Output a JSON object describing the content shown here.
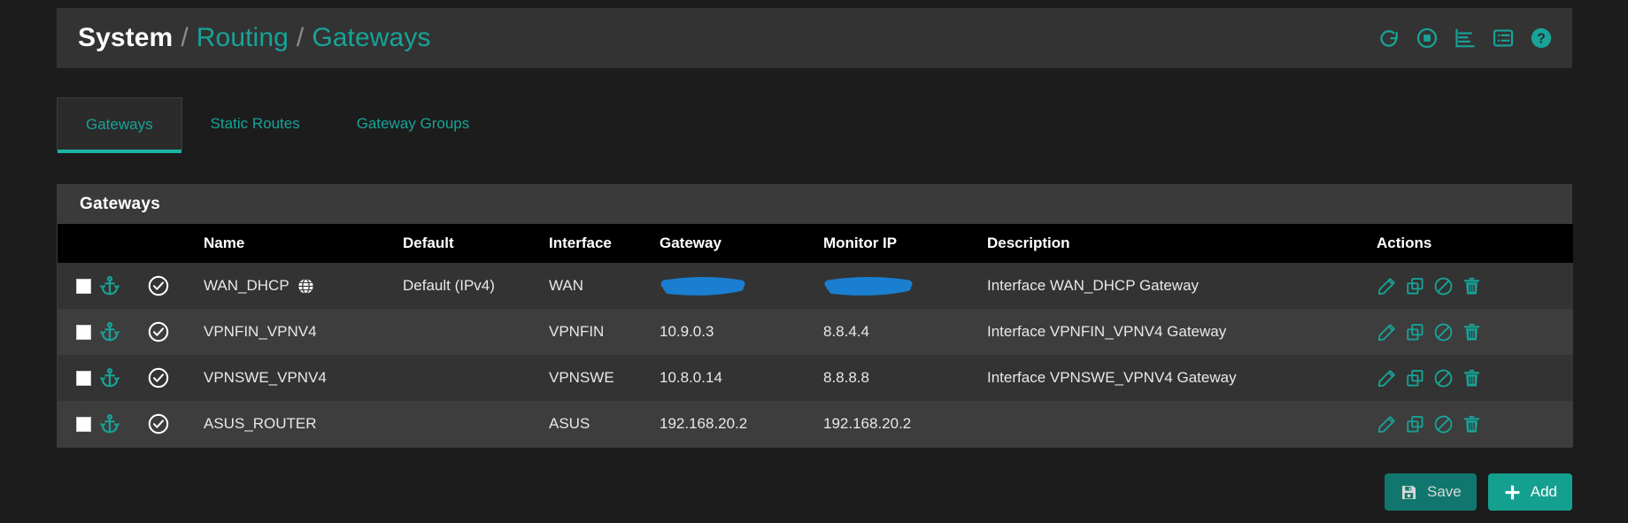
{
  "header": {
    "breadcrumb": {
      "section": "System",
      "separator": "/",
      "category": "Routing",
      "page": "Gateways"
    },
    "icons": [
      {
        "name": "restart-icon",
        "title": "Restart"
      },
      {
        "name": "stop-icon",
        "title": "Stop"
      },
      {
        "name": "log-icon",
        "title": "Logs"
      },
      {
        "name": "list-icon",
        "title": "Status"
      },
      {
        "name": "help-icon",
        "title": "Help"
      }
    ]
  },
  "tabs": [
    {
      "label": "Gateways",
      "active": true
    },
    {
      "label": "Static Routes",
      "active": false
    },
    {
      "label": "Gateway Groups",
      "active": false
    }
  ],
  "panel": {
    "title": "Gateways",
    "columns": [
      "",
      "",
      "Name",
      "Default",
      "Interface",
      "Gateway",
      "Monitor IP",
      "Description",
      "Actions"
    ],
    "rows": [
      {
        "selected": false,
        "anchor": "anchor-icon",
        "status": "check-circle-icon",
        "name": "WAN_DHCP",
        "name_badge": "globe-icon",
        "default": "Default (IPv4)",
        "interface": "WAN",
        "gateway": "",
        "gateway_redacted": true,
        "monitor_ip": "",
        "monitor_redacted": true,
        "description": "Interface WAN_DHCP Gateway"
      },
      {
        "selected": false,
        "anchor": "anchor-icon",
        "status": "check-circle-icon",
        "name": "VPNFIN_VPNV4",
        "name_badge": "",
        "default": "",
        "interface": "VPNFIN",
        "gateway": "10.9.0.3",
        "gateway_redacted": false,
        "monitor_ip": "8.8.4.4",
        "monitor_redacted": false,
        "description": "Interface VPNFIN_VPNV4 Gateway"
      },
      {
        "selected": false,
        "anchor": "anchor-icon",
        "status": "check-circle-icon",
        "name": "VPNSWE_VPNV4",
        "name_badge": "",
        "default": "",
        "interface": "VPNSWE",
        "gateway": "10.8.0.14",
        "gateway_redacted": false,
        "monitor_ip": "8.8.8.8",
        "monitor_redacted": false,
        "description": "Interface VPNSWE_VPNV4 Gateway"
      },
      {
        "selected": false,
        "anchor": "anchor-icon",
        "status": "check-circle-icon",
        "name": "ASUS_ROUTER",
        "name_badge": "",
        "default": "",
        "interface": "ASUS",
        "gateway": "192.168.20.2",
        "gateway_redacted": false,
        "monitor_ip": "192.168.20.2",
        "monitor_redacted": false,
        "description": ""
      }
    ],
    "row_actions": [
      {
        "name": "edit-icon",
        "title": "Edit"
      },
      {
        "name": "copy-icon",
        "title": "Copy"
      },
      {
        "name": "ban-icon",
        "title": "Disable"
      },
      {
        "name": "delete-icon",
        "title": "Delete"
      }
    ]
  },
  "footer": {
    "save_label": "Save",
    "save_icon": "save-icon",
    "add_label": "Add",
    "add_icon": "plus-icon"
  },
  "colors": {
    "accent_teal": "#17a398",
    "tab_underline": "#1bb3a4",
    "page_bg": "#1c1c1c",
    "header_bg": "#333333",
    "panel_bg": "#2f2f2f",
    "row_odd": "#333333",
    "row_even": "#3d3d3d",
    "thead_bg": "#000000",
    "redaction_blue": "#1a7fd0",
    "btn_save_bg": "#11776e",
    "btn_add_bg": "#14a08f"
  }
}
